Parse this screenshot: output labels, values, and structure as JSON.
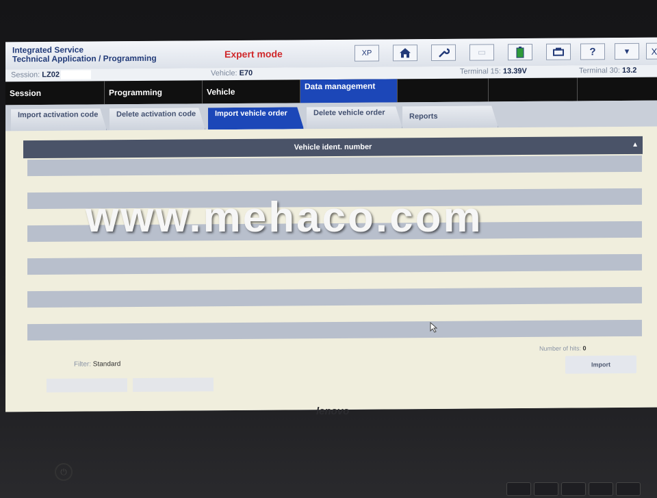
{
  "header": {
    "app_title_line1": "Integrated Service",
    "app_title_line2": "Technical Application / Programming",
    "mode": "Expert mode",
    "toolbar": [
      {
        "name": "xp-button",
        "label": "XP"
      },
      {
        "name": "home-icon",
        "label": "⌂"
      },
      {
        "name": "wrench-icon",
        "label": "✎"
      },
      {
        "name": "split-icon",
        "label": "▭"
      },
      {
        "name": "battery-icon",
        "label": "▮"
      },
      {
        "name": "print-icon",
        "label": "▤"
      },
      {
        "name": "help-icon",
        "label": "?"
      },
      {
        "name": "minimize-icon",
        "label": "▾"
      },
      {
        "name": "close-icon",
        "label": "X"
      }
    ]
  },
  "status": {
    "session_label": "Session:",
    "session_value": "LZ02",
    "vehicle_label": "Vehicle:",
    "vehicle_value": "E70",
    "terminal15_label": "Terminal 15:",
    "terminal15_value": "13.39V",
    "terminal30_label": "Terminal 30:",
    "terminal30_value": "13.2"
  },
  "nav": {
    "items": [
      {
        "label": "Session"
      },
      {
        "label": "Programming"
      },
      {
        "label": "Vehicle"
      },
      {
        "label": "Data management"
      }
    ]
  },
  "subtabs": [
    {
      "label": "Import activation code"
    },
    {
      "label": "Delete activation code"
    },
    {
      "label": "Import vehicle order"
    },
    {
      "label": "Delete vehicle order"
    },
    {
      "label": "Reports"
    }
  ],
  "grid": {
    "column_header": "Vehicle ident. number",
    "sort_icon": "▲"
  },
  "footer": {
    "hits_label": "Number of hits:",
    "hits_value": "0",
    "filter_label": "Filter:",
    "filter_value": "Standard",
    "import_label": "Import"
  },
  "watermark": "www.mehaco.com",
  "laptop": {
    "brand": "lenovo"
  },
  "colors": {
    "accent_blue": "#1c47b8",
    "expert_red": "#d0282b",
    "grid_header": "#4a5368"
  }
}
